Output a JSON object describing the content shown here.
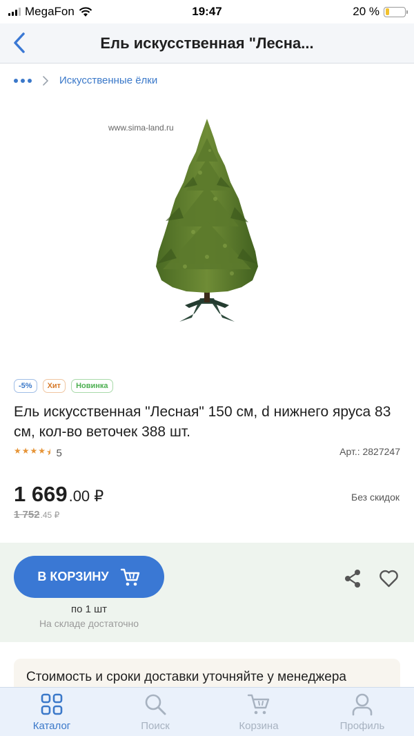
{
  "status_bar": {
    "carrier": "MegaFon",
    "time": "19:47",
    "battery_percent": "20 %",
    "battery_level": 0.2
  },
  "header": {
    "title": "Ель искусственная \"Лесна..."
  },
  "breadcrumb": {
    "items": [
      "Искусственные ёлки"
    ]
  },
  "product": {
    "watermark": "www.sima-land.ru",
    "badges": [
      "-5%",
      "Хит",
      "Новинка"
    ],
    "title": "Ель искусственная \"Лесная\" 150 см, d нижнего яруса 83 см, кол-во веточек 388 шт.",
    "rating": 4.5,
    "rating_count": "5",
    "article": "Арт.: 2827247",
    "price_main": "1 669",
    "price_cents": ".00 ₽",
    "price_old_main": "1 752",
    "price_old_cents": ".45 ₽",
    "discount_note": "Без скидок"
  },
  "cart": {
    "button_label": "В КОРЗИНУ",
    "per_unit": "по 1 шт",
    "stock": "На складе достаточно"
  },
  "delivery": {
    "text": "Стоимость и сроки доставки уточняйте у менеджера"
  },
  "tab_bar": {
    "tabs": [
      {
        "label": "Каталог",
        "icon": "grid-icon",
        "active": true
      },
      {
        "label": "Поиск",
        "icon": "search-icon",
        "active": false
      },
      {
        "label": "Корзина",
        "icon": "cart-icon",
        "active": false
      },
      {
        "label": "Профиль",
        "icon": "user-icon",
        "active": false
      }
    ]
  },
  "colors": {
    "accent": "#3a78d4",
    "cart_area_bg": "#eef4ee",
    "tab_bar_bg": "#eaf1fb",
    "star": "#e69437",
    "battery": "#f2c12e"
  }
}
